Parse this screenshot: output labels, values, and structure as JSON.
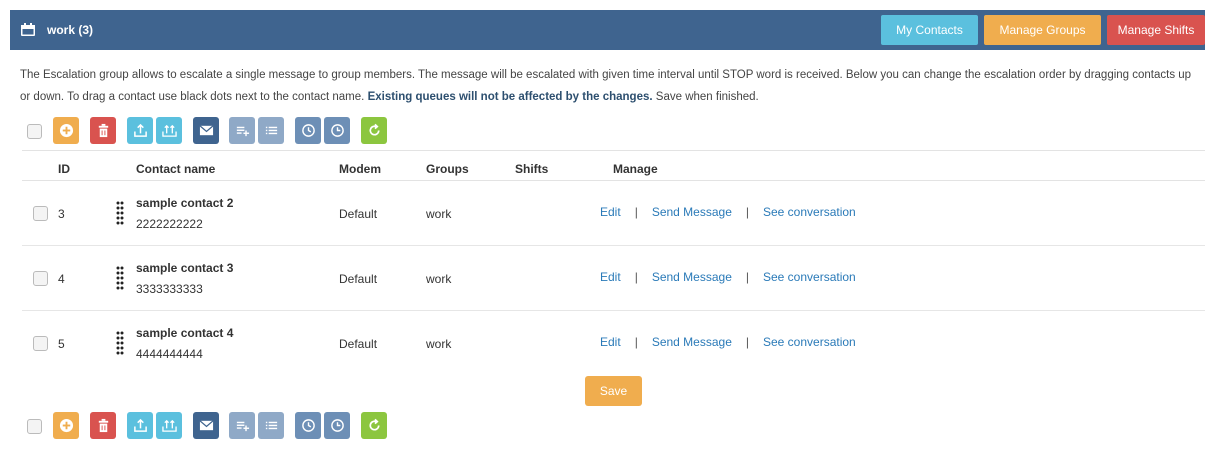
{
  "header": {
    "title": "work (3)",
    "buttons": {
      "my_contacts": "My Contacts",
      "manage_groups": "Manage Groups",
      "manage_shifts": "Manage Shifts"
    }
  },
  "description": {
    "part1": "The Escalation group allows to escalate a single message to group members. The message will be escalated with given time interval until STOP word is received. Below you can change the escalation order by dragging contacts up or down. To drag a contact use black dots next to the contact name.",
    "bold": "Existing queues will not be affected by the changes.",
    "part2": "Save when finished."
  },
  "toolbar_icons": [
    "add-icon",
    "delete-icon",
    "import-icon",
    "bulk-import-icon",
    "message-icon",
    "add-list-icon",
    "list-icon",
    "clock-icon",
    "schedule-icon",
    "refresh-icon"
  ],
  "table": {
    "headers": {
      "id": "ID",
      "name": "Contact name",
      "modem": "Modem",
      "groups": "Groups",
      "shifts": "Shifts",
      "manage": "Manage"
    },
    "rows": [
      {
        "id": "3",
        "name": "sample contact 2",
        "phone": "2222222222",
        "modem": "Default",
        "groups": "work",
        "shifts": ""
      },
      {
        "id": "4",
        "name": "sample contact 3",
        "phone": "3333333333",
        "modem": "Default",
        "groups": "work",
        "shifts": ""
      },
      {
        "id": "5",
        "name": "sample contact 4",
        "phone": "4444444444",
        "modem": "Default",
        "groups": "work",
        "shifts": ""
      }
    ],
    "actions": {
      "edit": "Edit",
      "send": "Send Message",
      "see": "See conversation",
      "separator": "|"
    }
  },
  "save_label": "Save",
  "colors": {
    "header": "#3f648f",
    "info": "#5bc0de",
    "warning": "#f0ad4e",
    "danger": "#d9534f",
    "success": "#8cc63f",
    "link": "#2a7ab8"
  }
}
